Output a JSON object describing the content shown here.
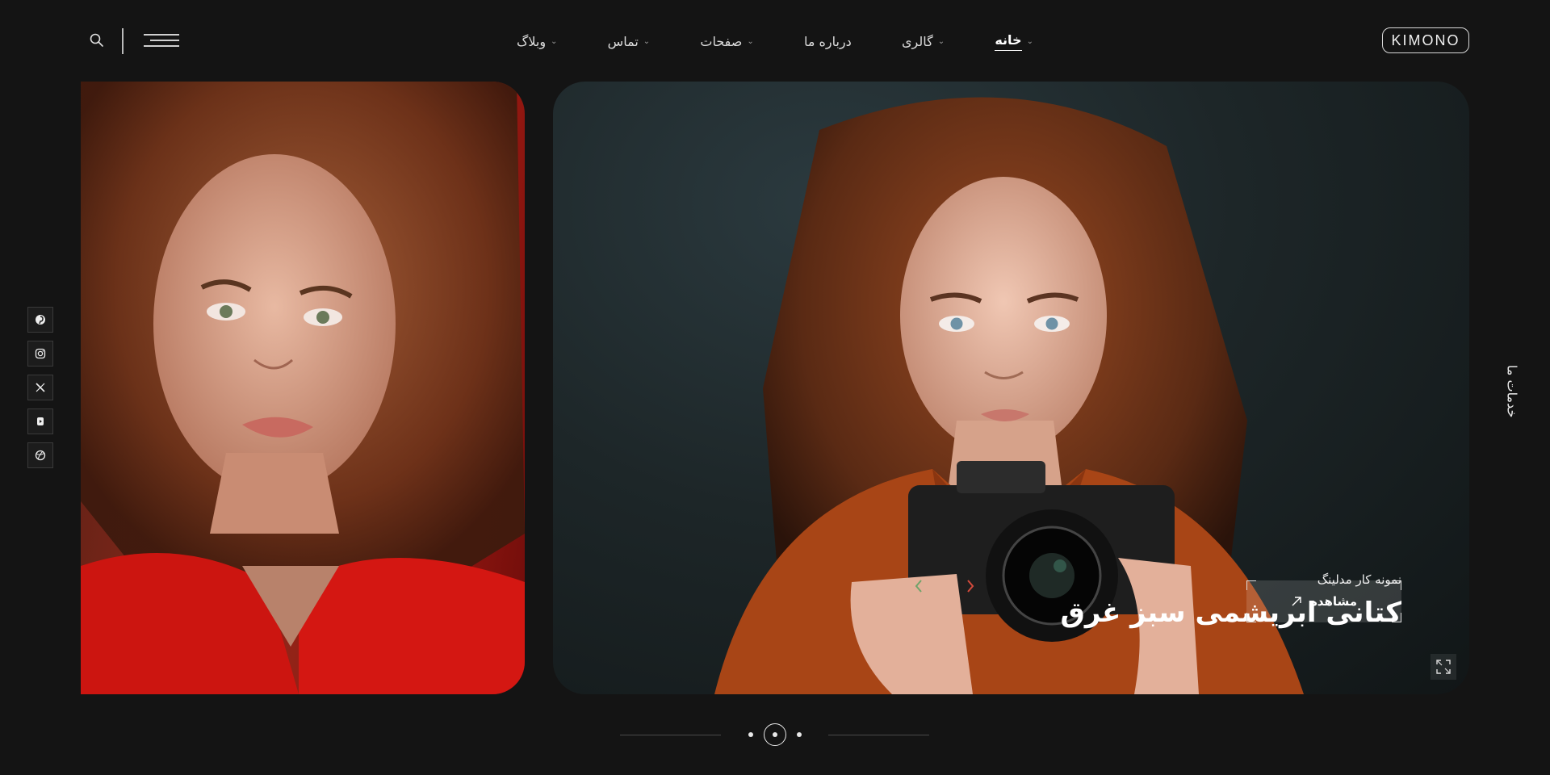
{
  "header": {
    "logo_text": "KIMONO",
    "nav": [
      {
        "label": "خانه",
        "active": true,
        "dropdown": true
      },
      {
        "label": "گالری",
        "active": false,
        "dropdown": true
      },
      {
        "label": "درباره ما",
        "active": false,
        "dropdown": false
      },
      {
        "label": "صفحات",
        "active": false,
        "dropdown": true
      },
      {
        "label": "تماس",
        "active": false,
        "dropdown": true
      },
      {
        "label": "وبلاگ",
        "active": false,
        "dropdown": true
      }
    ],
    "menu_icon": "hamburger-icon",
    "search_icon": "search-icon"
  },
  "sidebar": {
    "services_label": "خدمات ما",
    "socials": [
      "pinterest-icon",
      "instagram-icon",
      "x-icon",
      "youtube-icon",
      "dribbble-icon"
    ]
  },
  "slide": {
    "subtitle": "نمونه کار مدلینگ",
    "title": "کتانی ابریشمی سبز غرق",
    "button_label": "مشاهده"
  },
  "pagination": {
    "count": 3,
    "active": 2
  }
}
